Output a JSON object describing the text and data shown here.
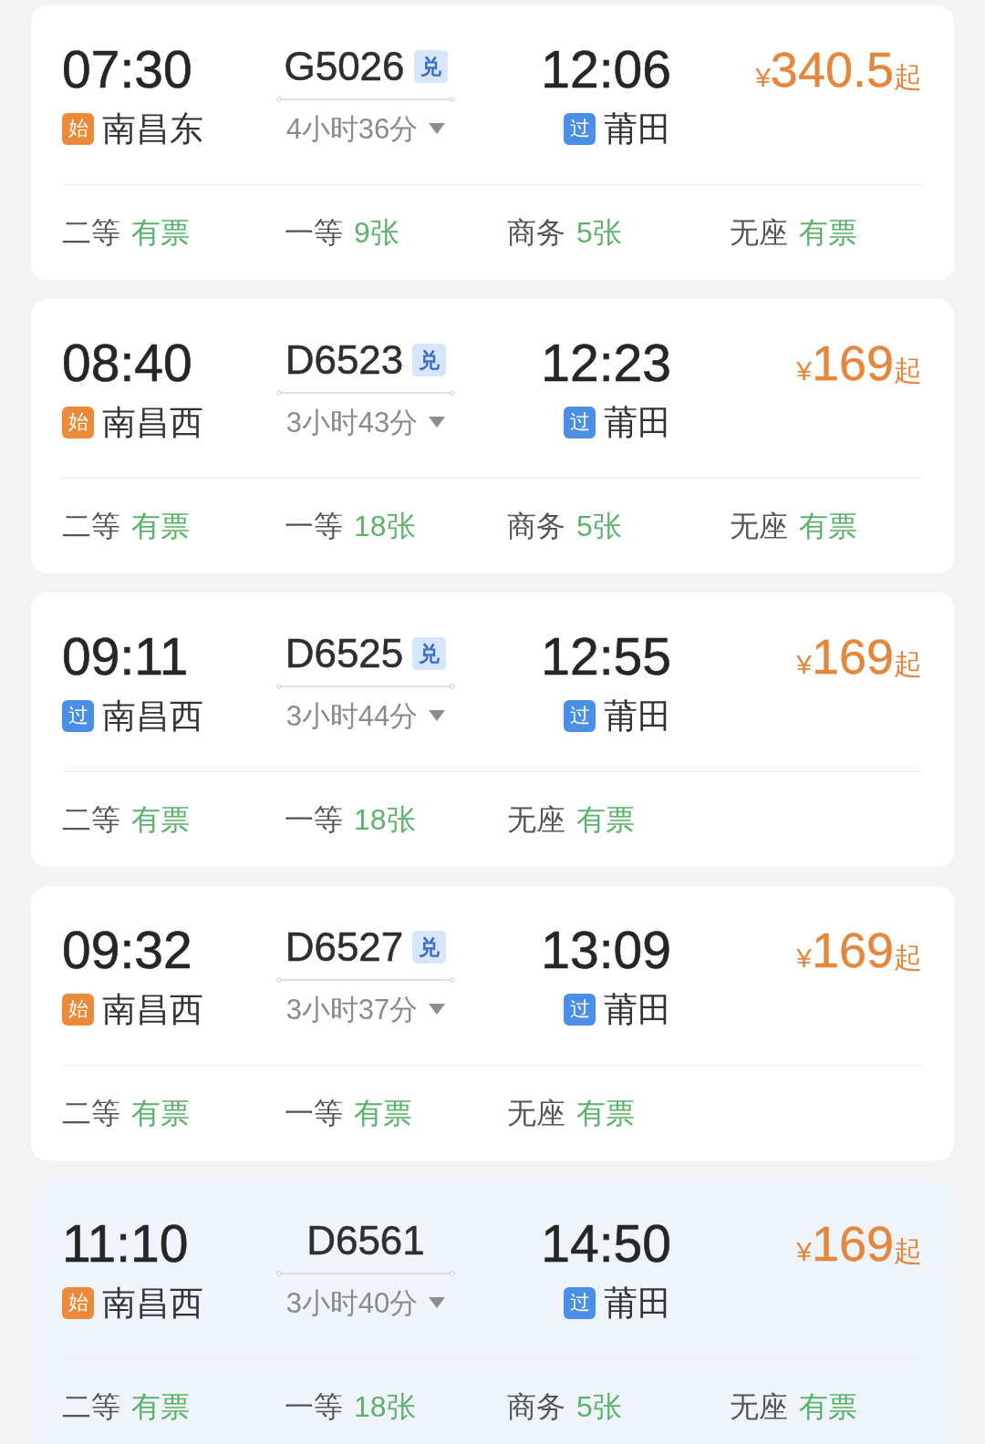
{
  "trains": [
    {
      "highlighted": false,
      "depart_time": "07:30",
      "depart_station": {
        "tag": "始",
        "kind": "origin",
        "name": "南昌东"
      },
      "train_number": "G5026",
      "badge": "兑",
      "duration": "4小时36分",
      "arrive_time": "12:06",
      "arrive_station": {
        "tag": "过",
        "kind": "pass",
        "name": "莆田"
      },
      "price": {
        "currency": "¥",
        "amount": "340.5",
        "suffix": "起"
      },
      "seats": [
        {
          "class": "二等",
          "availability": "有票"
        },
        {
          "class": "一等",
          "availability": "9张"
        },
        {
          "class": "商务",
          "availability": "5张"
        },
        {
          "class": "无座",
          "availability": "有票"
        }
      ]
    },
    {
      "highlighted": false,
      "depart_time": "08:40",
      "depart_station": {
        "tag": "始",
        "kind": "origin",
        "name": "南昌西"
      },
      "train_number": "D6523",
      "badge": "兑",
      "duration": "3小时43分",
      "arrive_time": "12:23",
      "arrive_station": {
        "tag": "过",
        "kind": "pass",
        "name": "莆田"
      },
      "price": {
        "currency": "¥",
        "amount": "169",
        "suffix": "起"
      },
      "seats": [
        {
          "class": "二等",
          "availability": "有票"
        },
        {
          "class": "一等",
          "availability": "18张"
        },
        {
          "class": "商务",
          "availability": "5张"
        },
        {
          "class": "无座",
          "availability": "有票"
        }
      ]
    },
    {
      "highlighted": false,
      "depart_time": "09:11",
      "depart_station": {
        "tag": "过",
        "kind": "pass",
        "name": "南昌西"
      },
      "train_number": "D6525",
      "badge": "兑",
      "duration": "3小时44分",
      "arrive_time": "12:55",
      "arrive_station": {
        "tag": "过",
        "kind": "pass",
        "name": "莆田"
      },
      "price": {
        "currency": "¥",
        "amount": "169",
        "suffix": "起"
      },
      "seats": [
        {
          "class": "二等",
          "availability": "有票"
        },
        {
          "class": "一等",
          "availability": "18张"
        },
        {
          "class": "无座",
          "availability": "有票"
        }
      ]
    },
    {
      "highlighted": false,
      "depart_time": "09:32",
      "depart_station": {
        "tag": "始",
        "kind": "origin",
        "name": "南昌西"
      },
      "train_number": "D6527",
      "badge": "兑",
      "duration": "3小时37分",
      "arrive_time": "13:09",
      "arrive_station": {
        "tag": "过",
        "kind": "pass",
        "name": "莆田"
      },
      "price": {
        "currency": "¥",
        "amount": "169",
        "suffix": "起"
      },
      "seats": [
        {
          "class": "二等",
          "availability": "有票"
        },
        {
          "class": "一等",
          "availability": "有票"
        },
        {
          "class": "无座",
          "availability": "有票"
        }
      ]
    },
    {
      "highlighted": true,
      "depart_time": "11:10",
      "depart_station": {
        "tag": "始",
        "kind": "origin",
        "name": "南昌西"
      },
      "train_number": "D6561",
      "duration": "3小时40分",
      "arrive_time": "14:50",
      "arrive_station": {
        "tag": "过",
        "kind": "pass",
        "name": "莆田"
      },
      "price": {
        "currency": "¥",
        "amount": "169",
        "suffix": "起"
      },
      "seats": [
        {
          "class": "二等",
          "availability": "有票"
        },
        {
          "class": "一等",
          "availability": "18张"
        },
        {
          "class": "商务",
          "availability": "5张"
        },
        {
          "class": "无座",
          "availability": "有票"
        }
      ]
    }
  ]
}
